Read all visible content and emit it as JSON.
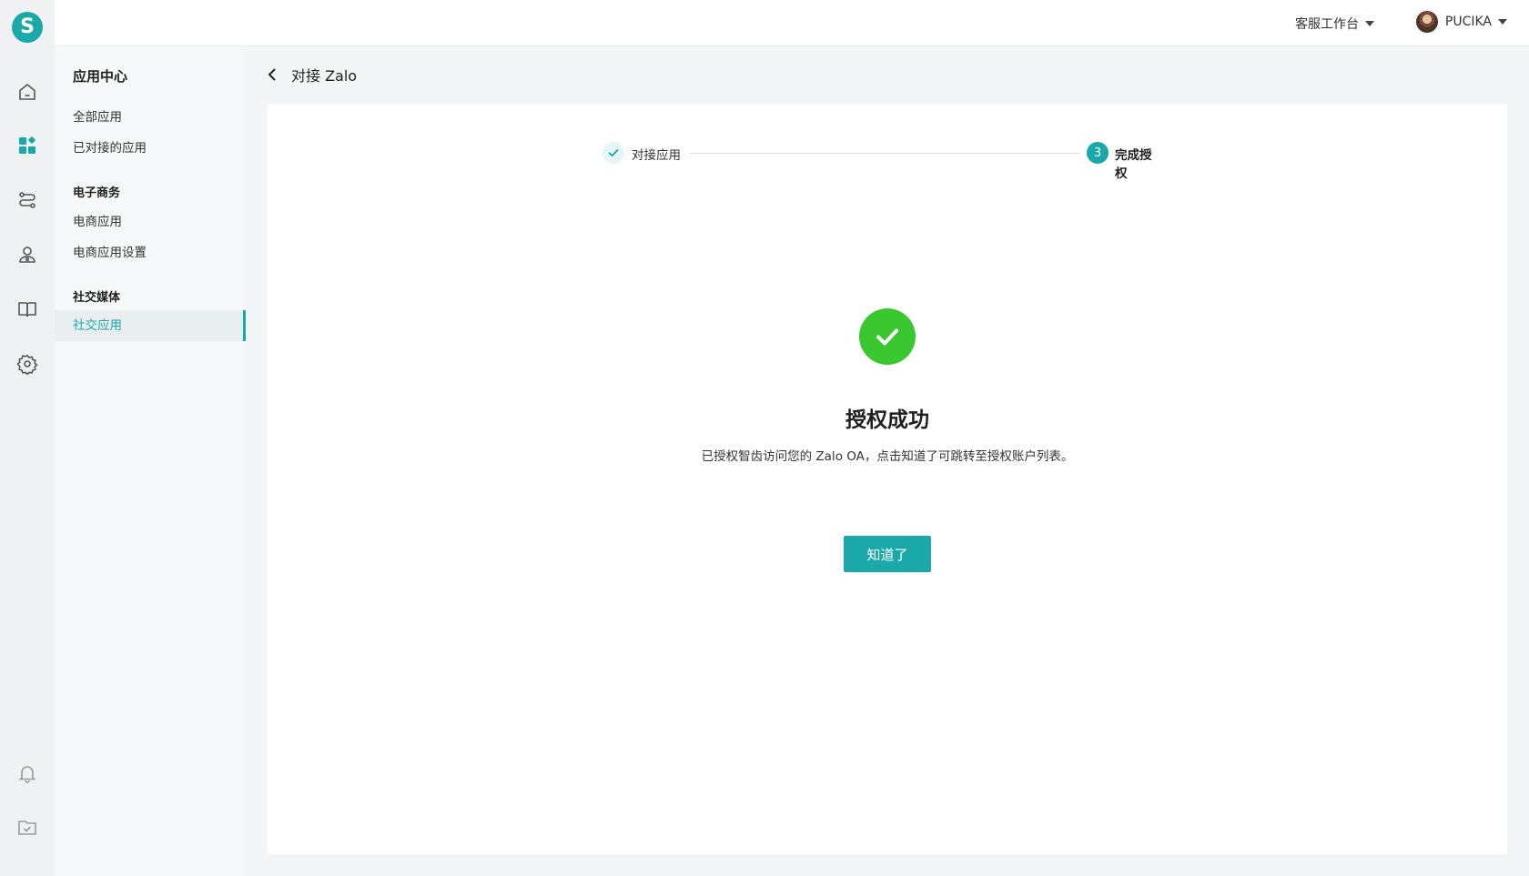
{
  "brand": {
    "logo_letter": "S",
    "accent": "#1aa8a8",
    "success": "#3ac730"
  },
  "rail": {
    "items": [
      {
        "icon": "home-icon"
      },
      {
        "icon": "apps-icon",
        "active": true
      },
      {
        "icon": "route-icon"
      },
      {
        "icon": "contacts-icon"
      },
      {
        "icon": "book-icon"
      },
      {
        "icon": "gear-icon"
      },
      {
        "icon": "bell-icon"
      },
      {
        "icon": "inbox-icon"
      }
    ]
  },
  "topbar": {
    "workbench_label": "客服工作台",
    "user_name": "PUCIKA"
  },
  "sidebar": {
    "title": "应用中心",
    "items": [
      {
        "label": "全部应用"
      },
      {
        "label": "已对接的应用"
      }
    ],
    "groups": [
      {
        "title": "电子商务",
        "items": [
          {
            "label": "电商应用"
          },
          {
            "label": "电商应用设置"
          }
        ]
      },
      {
        "title": "社交媒体",
        "items": [
          {
            "label": "社交应用",
            "active": true
          }
        ]
      }
    ]
  },
  "page": {
    "title": "对接 Zalo"
  },
  "steps": [
    {
      "label": "对接应用",
      "status": "done"
    },
    {
      "label": "完成授权",
      "status": "active",
      "number": "3"
    }
  ],
  "result": {
    "title": "授权成功",
    "description": "已授权智齿访问您的 Zalo OA，点击知道了可跳转至授权账户列表。",
    "button_label": "知道了"
  }
}
